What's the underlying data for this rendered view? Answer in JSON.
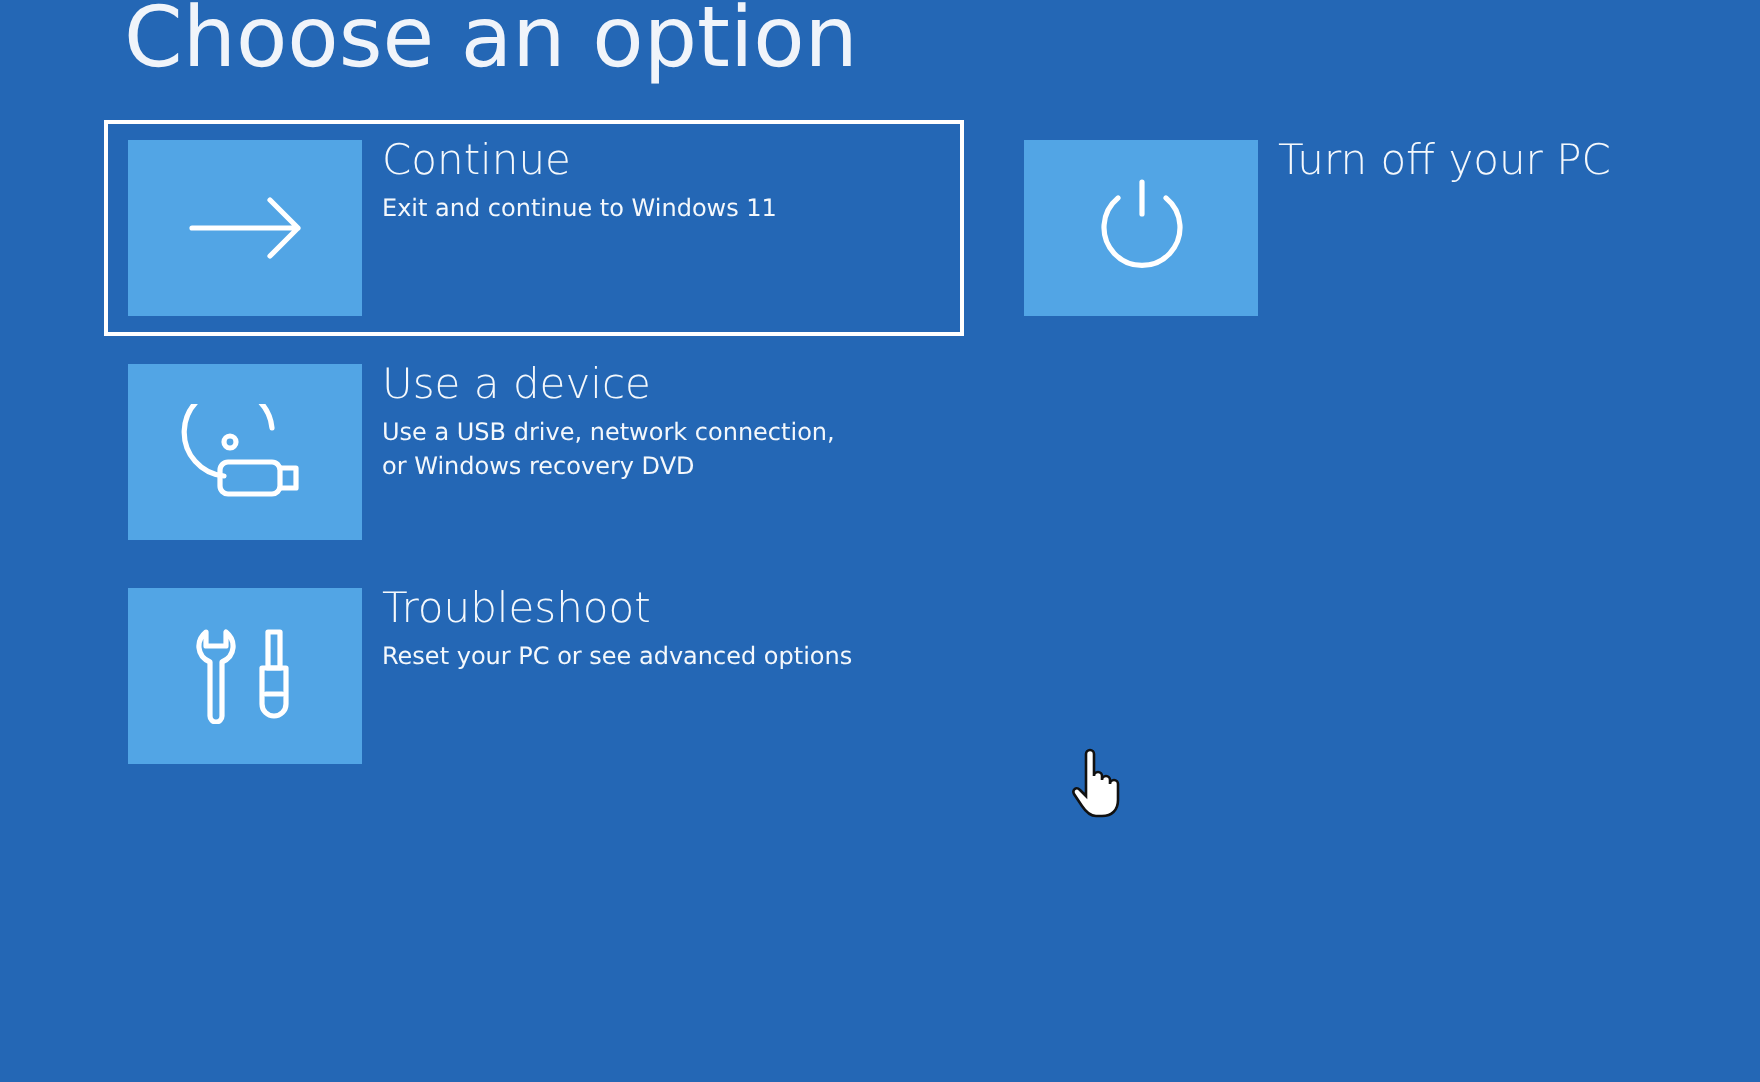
{
  "title": "Choose an option",
  "columns": [
    {
      "options": [
        {
          "kind": "arrow",
          "label": "Continue",
          "description": "Exit and continue to Windows 11",
          "selected": true
        },
        {
          "kind": "device",
          "label": "Use a device",
          "description": "Use a USB drive, network connection,\nor Windows recovery DVD",
          "selected": false
        },
        {
          "kind": "tools",
          "label": "Troubleshoot",
          "description": "Reset your PC or see advanced options",
          "selected": false
        }
      ]
    },
    {
      "options": [
        {
          "kind": "power",
          "label": "Turn off your PC",
          "selected": false
        }
      ]
    }
  ]
}
